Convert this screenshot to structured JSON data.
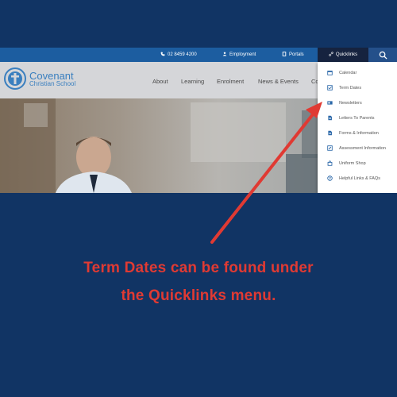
{
  "topbar": {
    "phone": "02 8459 4200",
    "employment": "Employment",
    "portals": "Portals",
    "quicklinks": "Quicklinks"
  },
  "logo": {
    "line1": "Covenant",
    "line2": "Christian School"
  },
  "nav": [
    "About",
    "Learning",
    "Enrolment",
    "News & Events",
    "Co"
  ],
  "quicklinks_menu": [
    "Calendar",
    "Term Dates",
    "Newsletters",
    "Letters To Parents",
    "Forms & Information",
    "Assessment Information",
    "Uniform Shop",
    "Helpful Links & FAQs"
  ],
  "caption": {
    "line1": "Term Dates can be found under",
    "line2": "the Quicklinks menu."
  },
  "colors": {
    "background": "#113464",
    "accent_red": "#e03a33",
    "topbar_blue": "#1c5da0",
    "quicklinks_dark": "#16233f"
  }
}
